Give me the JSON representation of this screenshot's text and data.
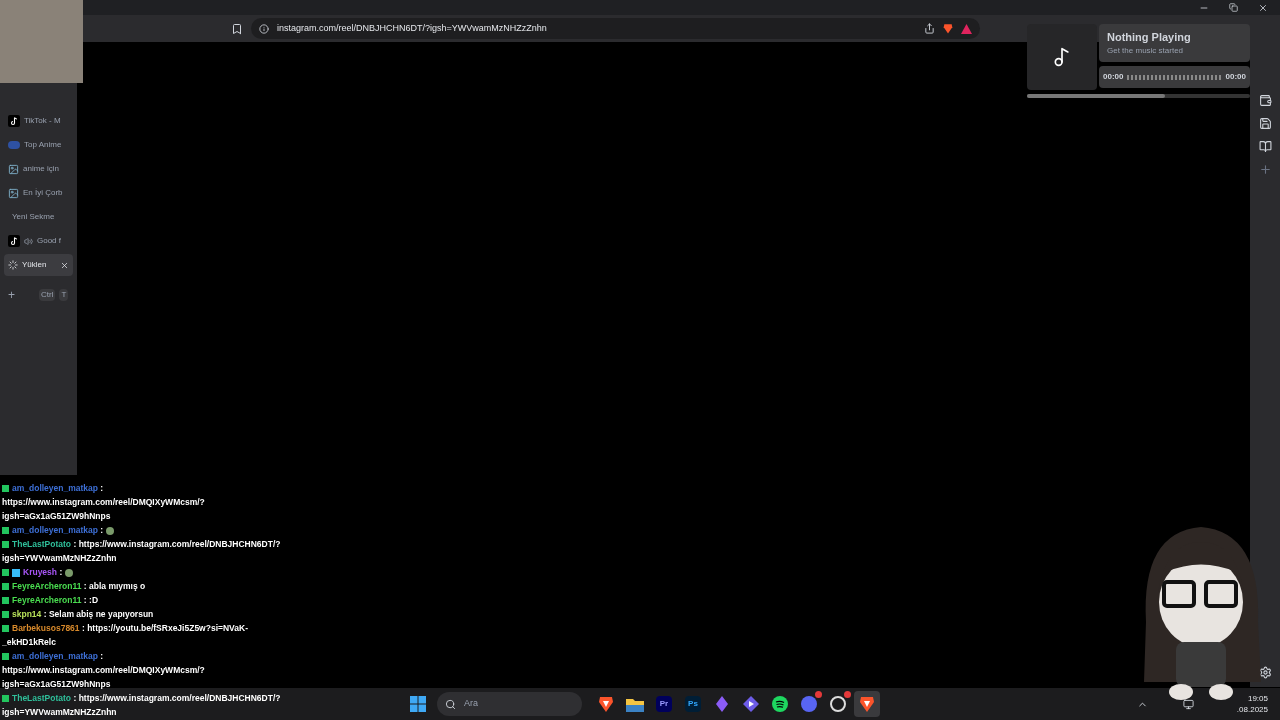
{
  "address_bar": {
    "url": "instagram.com/reel/DNBJHCHN6DT/?igsh=YWVwamMzNHZzZnhn"
  },
  "tabs": [
    {
      "title": "TikTok - M",
      "kind": "tiktok",
      "audio": false,
      "loading": false,
      "selected": false
    },
    {
      "title": "Top Anime",
      "kind": "mal",
      "audio": false,
      "loading": false,
      "selected": false
    },
    {
      "title": "anime için",
      "kind": "image",
      "audio": false,
      "loading": false,
      "selected": false
    },
    {
      "title": "En İyi Çorb",
      "kind": "image",
      "audio": false,
      "loading": false,
      "selected": false
    },
    {
      "title": "Yeni Sekme",
      "kind": "plain",
      "audio": false,
      "loading": false,
      "selected": false
    },
    {
      "title": "Good f",
      "kind": "tiktok",
      "audio": true,
      "loading": false,
      "selected": false
    },
    {
      "title": "Yüklen",
      "kind": "plain",
      "audio": false,
      "loading": true,
      "selected": true
    }
  ],
  "new_tab": {
    "label": "+",
    "keys": [
      "Ctrl",
      "T"
    ]
  },
  "music_widget": {
    "title": "Nothing Playing",
    "subtitle": "Get the music started",
    "elapsed": "00:00",
    "duration": "00:00",
    "level": 0.62
  },
  "chat": [
    {
      "user": "am_dolleyen_matkap",
      "color": "#3d6fd6",
      "separator": ":",
      "continuation": [
        "https://www.instagram.com/reel/DMQIXyWMcsm/?",
        "igsh=aGx1aG51ZW9hNnps"
      ],
      "emote": false,
      "extra_badge": false
    },
    {
      "user": "am_dolleyen_matkap",
      "color": "#3d6fd6",
      "separator": ":",
      "emote": true,
      "extra_badge": false
    },
    {
      "user": "TheLastPotato",
      "color": "#2fbf9a",
      "separator": ":",
      "text": "https://www.instagram.com/reel/DNBJHCHN6DT/?",
      "continuation": [
        "igsh=YWVwamMzNHZzZnhn"
      ],
      "emote": false,
      "extra_badge": false
    },
    {
      "user": "Kruyesh",
      "color": "#a855f7",
      "separator": ":",
      "emote": true,
      "extra_badge": true
    },
    {
      "user": "FeyreArcheron11",
      "color": "#4ade50",
      "separator": ":",
      "text": "abla mıymış o",
      "emote": false,
      "extra_badge": false
    },
    {
      "user": "FeyreArcheron11",
      "color": "#4ade50",
      "separator": ":",
      "text": ":D",
      "emote": false,
      "extra_badge": false
    },
    {
      "user": "skpn14",
      "color": "#b9e35a",
      "separator": ":",
      "text": "Selam abiş ne yapıyorsun",
      "emote": false,
      "extra_badge": false
    },
    {
      "user": "Barbekusos7861",
      "color": "#d98a2b",
      "separator": ":",
      "text": "https://youtu.be/fSRxeJi5Z5w?si=NVaK-",
      "continuation": [
        "_ekHD1kRelc"
      ],
      "emote": false,
      "extra_badge": false
    },
    {
      "user": "am_dolleyen_matkap",
      "color": "#3d6fd6",
      "separator": ":",
      "continuation": [
        "https://www.instagram.com/reel/DMQIXyWMcsm/?",
        "igsh=aGx1aG51ZW9hNnps"
      ],
      "emote": false,
      "extra_badge": false
    },
    {
      "user": "TheLastPotato",
      "color": "#2fbf9a",
      "separator": ":",
      "text": "https://www.instagram.com/reel/DNBJHCHN6DT/?",
      "continuation": [
        "igsh=YWVwamMzNHZzZnhn"
      ],
      "emote": false,
      "extra_badge": false
    }
  ],
  "taskbar": {
    "search_placeholder": "Ara",
    "apps": [
      {
        "kind": "brave",
        "badge": false,
        "selected": false
      },
      {
        "kind": "folder",
        "badge": false,
        "selected": false
      },
      {
        "kind": "premiere",
        "label": "Pr",
        "badge": false,
        "selected": false
      },
      {
        "kind": "photoshop",
        "label": "Ps",
        "badge": false,
        "selected": false
      },
      {
        "kind": "crystal",
        "badge": false,
        "selected": false
      },
      {
        "kind": "diamond",
        "badge": false,
        "selected": false
      },
      {
        "kind": "spotify",
        "badge": false,
        "selected": false
      },
      {
        "kind": "discord",
        "badge": true,
        "selected": false
      },
      {
        "kind": "obs",
        "badge": true,
        "selected": false
      },
      {
        "kind": "brave",
        "badge": false,
        "selected": true
      }
    ],
    "time": "19:05",
    "date": ".08.2025"
  }
}
